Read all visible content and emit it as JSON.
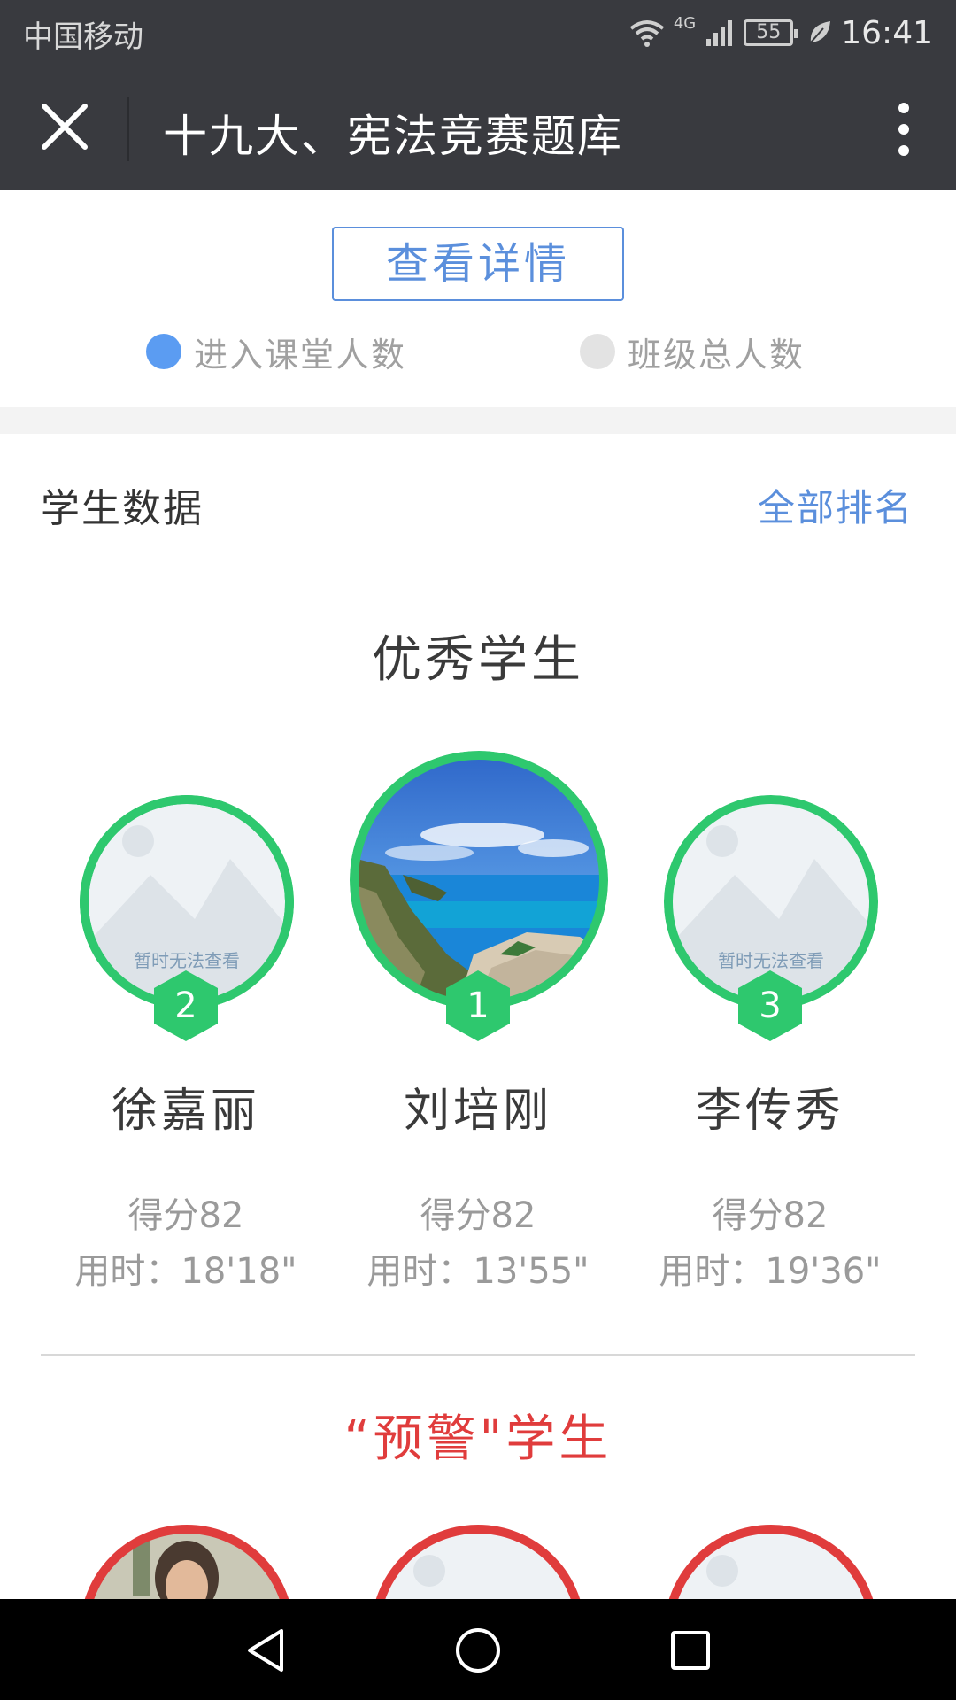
{
  "status_bar": {
    "carrier": "中国移动",
    "network": "4G",
    "battery": "55",
    "time": "16:41"
  },
  "nav": {
    "title": "十九大、宪法竞赛题库"
  },
  "detail": {
    "button_label": "查看详情",
    "legend": [
      {
        "label": "进入课堂人数",
        "color": "#5b9cf2"
      },
      {
        "label": "班级总人数",
        "color": "#e3e3e3"
      }
    ]
  },
  "student_data": {
    "title": "学生数据",
    "all_rank_label": "全部排名"
  },
  "excellent": {
    "heading": "优秀学生",
    "placeholder_text": "暂时无法查看",
    "ring_color": "#2ec86e",
    "students": [
      {
        "rank": "2",
        "name": "徐嘉丽",
        "score": "得分82",
        "time": "用时：18'18\"",
        "avatar": "placeholder-image-icon"
      },
      {
        "rank": "1",
        "name": "刘培刚",
        "score": "得分82",
        "time": "用时：13'55\"",
        "avatar": "landscape-photo"
      },
      {
        "rank": "3",
        "name": "李传秀",
        "score": "得分82",
        "time": "用时：19'36\"",
        "avatar": "placeholder-image-icon"
      }
    ]
  },
  "warning": {
    "heading": "“预警\"学生",
    "ring_color": "#e03c3c"
  },
  "android_nav": {
    "icons": [
      "back-icon",
      "home-icon",
      "recents-icon"
    ]
  }
}
